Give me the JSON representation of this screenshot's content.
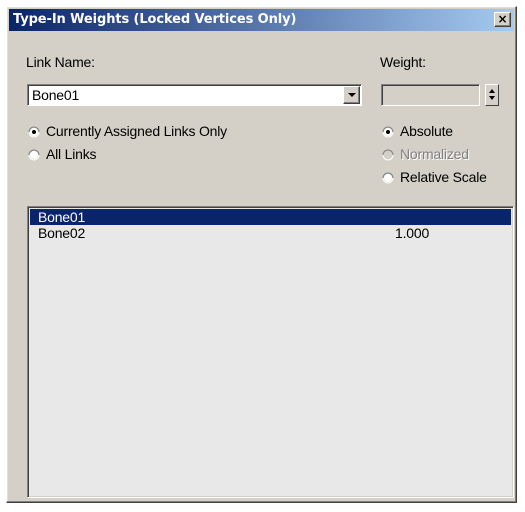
{
  "window": {
    "title": "Type-In Weights (Locked Vertices Only)",
    "close_glyph": "×"
  },
  "link_name": {
    "label": "Link Name:",
    "selected": "Bone01"
  },
  "weight": {
    "label": "Weight:",
    "value": ""
  },
  "link_filter": {
    "options": [
      {
        "label": "Currently Assigned Links Only",
        "checked": true,
        "enabled": true
      },
      {
        "label": "All Links",
        "checked": false,
        "enabled": true
      }
    ]
  },
  "weight_mode": {
    "options": [
      {
        "label": "Absolute",
        "checked": true,
        "enabled": true
      },
      {
        "label": "Normalized",
        "checked": false,
        "enabled": false
      },
      {
        "label": "Relative Scale",
        "checked": false,
        "enabled": true
      }
    ]
  },
  "links": [
    {
      "name": "Bone01",
      "weight": "",
      "selected": true
    },
    {
      "name": "Bone02",
      "weight": "1.000",
      "selected": false
    }
  ],
  "colors": {
    "dialog_bg": "#d4d0c8",
    "titlebar_start": "#0a246a",
    "titlebar_end": "#a6caf0",
    "selection": "#0a246a",
    "list_bg": "#e8e8e8"
  }
}
